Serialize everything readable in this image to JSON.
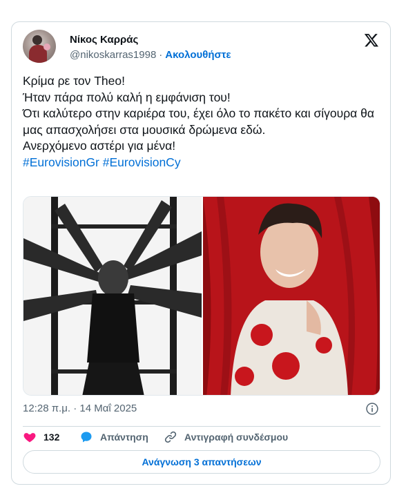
{
  "author": {
    "display_name": "Νίκος Καρράς",
    "handle": "@nikoskarras1998",
    "separator": "·",
    "follow_label": "Ακολουθήστε"
  },
  "brand": {
    "icon": "x-logo-icon"
  },
  "tweet": {
    "text": "Κρίμα ρε τον Theo!\nΉταν  πάρα πολύ καλή η εμφάνιση του!\nΌτι καλύτερο στην καριέρα του, έχει όλο το πακέτο και σίγουρα θα μας απασχολήσει στα μουσικά δρώμενα εδώ.\nΑνερχόμενο αστέρι για μένα!",
    "hashtags": "#EurovisionGr #EurovisionCy"
  },
  "meta": {
    "timestamp": "12:28 π.μ. · 14 Μαΐ 2025",
    "info_icon": "info-icon"
  },
  "actions": {
    "like_count": "132",
    "reply_label": "Απάντηση",
    "copy_link_label": "Αντιγραφή συνδέσμου"
  },
  "read_replies_label": "Ανάγνωση 3 απαντήσεων",
  "colors": {
    "accent": "#006fd6",
    "like": "#f91880",
    "secondary_text": "#536471",
    "border": "#cfd9de",
    "photo_bg_right": "#c71f1f"
  }
}
